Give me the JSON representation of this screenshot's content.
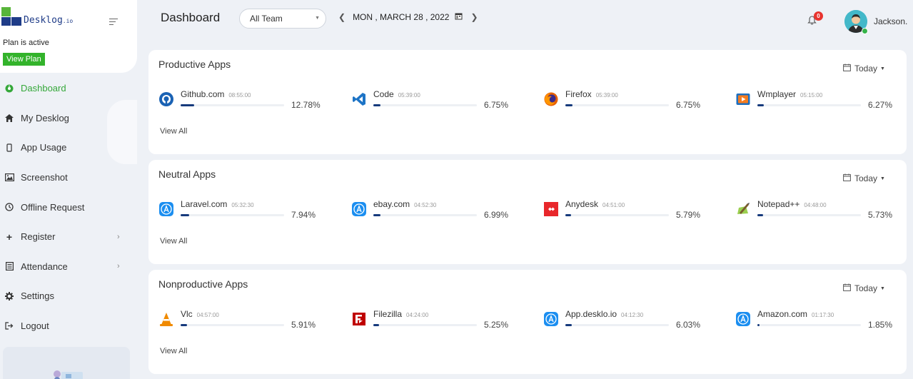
{
  "brand": {
    "name": "Desklog",
    "suffix": ".io"
  },
  "plan": {
    "status": "Plan is active",
    "button_label": "View Plan"
  },
  "nav": [
    {
      "label": "Dashboard",
      "icon": "dashboard-icon",
      "active": true
    },
    {
      "label": "My Desklog",
      "icon": "home-icon"
    },
    {
      "label": "App Usage",
      "icon": "mobile-icon"
    },
    {
      "label": "Screenshot",
      "icon": "image-icon"
    },
    {
      "label": "Offline Request",
      "icon": "clock-icon"
    },
    {
      "label": "Register",
      "icon": "plus-icon",
      "expandable": true
    },
    {
      "label": "Attendance",
      "icon": "calendar-list-icon",
      "expandable": true
    },
    {
      "label": "Settings",
      "icon": "gear-icon"
    },
    {
      "label": "Logout",
      "icon": "logout-icon"
    }
  ],
  "header": {
    "title": "Dashboard",
    "team_select": "All Team",
    "date": "MON , MARCH 28 , 2022",
    "notification_count": "0",
    "user_name": "Jackson."
  },
  "sections": [
    {
      "title": "Productive Apps",
      "period": "Today",
      "view_all": "View All",
      "apps": [
        {
          "name": "Github.com",
          "time": "08:55:00",
          "percent": "12.78%",
          "share": 12.78,
          "icon": "github-icon"
        },
        {
          "name": "Code",
          "time": "05:39:00",
          "percent": "6.75%",
          "share": 6.75,
          "icon": "vscode-icon"
        },
        {
          "name": "Firefox",
          "time": "05:39:00",
          "percent": "6.75%",
          "share": 6.75,
          "icon": "firefox-icon"
        },
        {
          "name": "Wmplayer",
          "time": "05:15:00",
          "percent": "6.27%",
          "share": 6.27,
          "icon": "media-player-icon"
        }
      ]
    },
    {
      "title": "Neutral Apps",
      "period": "Today",
      "view_all": "View All",
      "apps": [
        {
          "name": "Laravel.com",
          "time": "05:32:30",
          "percent": "7.94%",
          "share": 7.94,
          "icon": "app-store-icon"
        },
        {
          "name": "ebay.com",
          "time": "04:52:30",
          "percent": "6.99%",
          "share": 6.99,
          "icon": "app-store-icon"
        },
        {
          "name": "Anydesk",
          "time": "04:51:00",
          "percent": "5.79%",
          "share": 5.79,
          "icon": "anydesk-icon"
        },
        {
          "name": "Notepad++",
          "time": "04:48:00",
          "percent": "5.73%",
          "share": 5.73,
          "icon": "notepad-plus-plus-icon"
        }
      ]
    },
    {
      "title": "Nonproductive Apps",
      "period": "Today",
      "view_all": "View All",
      "apps": [
        {
          "name": "Vlc",
          "time": "04:57:00",
          "percent": "5.91%",
          "share": 5.91,
          "icon": "vlc-icon"
        },
        {
          "name": "Filezilla",
          "time": "04:24:00",
          "percent": "5.25%",
          "share": 5.25,
          "icon": "filezilla-icon"
        },
        {
          "name": "App.desklo.io",
          "time": "04:12:30",
          "percent": "6.03%",
          "share": 6.03,
          "icon": "app-store-icon"
        },
        {
          "name": "Amazon.com",
          "time": "01:17:30",
          "percent": "1.85%",
          "share": 1.85,
          "icon": "app-store-icon"
        }
      ]
    }
  ],
  "colors": {
    "accent": "#35a83a",
    "progress": "#163a7c",
    "brand_blue": "#1f3c88",
    "badge": "#e8342f"
  }
}
